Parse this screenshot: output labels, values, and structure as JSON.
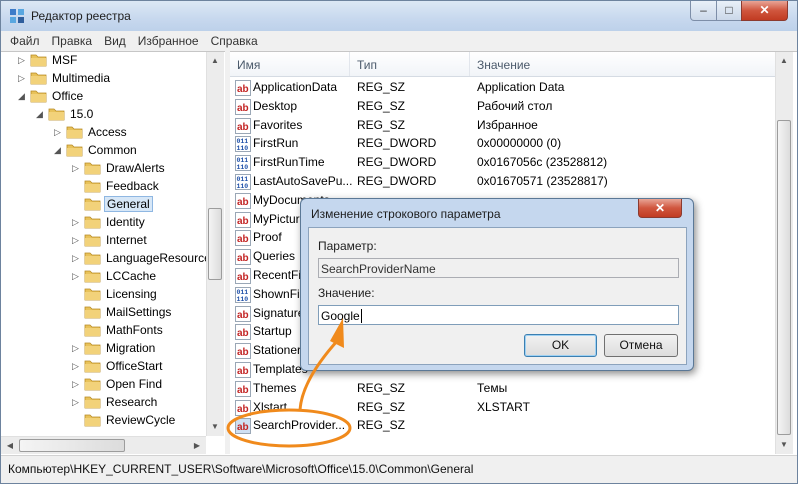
{
  "window": {
    "title": "Редактор реестра"
  },
  "caption": {
    "minimize": "–",
    "maximize": "□",
    "close": "✕"
  },
  "menu": [
    "Файл",
    "Правка",
    "Вид",
    "Избранное",
    "Справка"
  ],
  "tree": [
    {
      "label": "MSF",
      "level": 1,
      "expander": "▷"
    },
    {
      "label": "Multimedia",
      "level": 1,
      "expander": "▷"
    },
    {
      "label": "Office",
      "level": 1,
      "expander": "◢"
    },
    {
      "label": "15.0",
      "level": 2,
      "expander": "◢"
    },
    {
      "label": "Access",
      "level": 3,
      "expander": "▷"
    },
    {
      "label": "Common",
      "level": 3,
      "expander": "◢"
    },
    {
      "label": "DrawAlerts",
      "level": 4,
      "expander": "▷"
    },
    {
      "label": "Feedback",
      "level": 4,
      "expander": ""
    },
    {
      "label": "General",
      "level": 4,
      "expander": "",
      "selected": true
    },
    {
      "label": "Identity",
      "level": 4,
      "expander": "▷"
    },
    {
      "label": "Internet",
      "level": 4,
      "expander": "▷"
    },
    {
      "label": "LanguageResources",
      "level": 4,
      "expander": "▷"
    },
    {
      "label": "LCCache",
      "level": 4,
      "expander": "▷"
    },
    {
      "label": "Licensing",
      "level": 4,
      "expander": ""
    },
    {
      "label": "MailSettings",
      "level": 4,
      "expander": ""
    },
    {
      "label": "MathFonts",
      "level": 4,
      "expander": ""
    },
    {
      "label": "Migration",
      "level": 4,
      "expander": "▷"
    },
    {
      "label": "OfficeStart",
      "level": 4,
      "expander": "▷"
    },
    {
      "label": "Open Find",
      "level": 4,
      "expander": "▷"
    },
    {
      "label": "Research",
      "level": 4,
      "expander": "▷"
    },
    {
      "label": "ReviewCycle",
      "level": 4,
      "expander": ""
    }
  ],
  "list": {
    "headers": {
      "name": "Имя",
      "type": "Тип",
      "value": "Значение"
    },
    "rows": [
      {
        "name": "ApplicationData",
        "type": "REG_SZ",
        "value": "Application Data",
        "icon": "ab"
      },
      {
        "name": "Desktop",
        "type": "REG_SZ",
        "value": "Рабочий стол",
        "icon": "ab"
      },
      {
        "name": "Favorites",
        "type": "REG_SZ",
        "value": "Избранное",
        "icon": "ab"
      },
      {
        "name": "FirstRun",
        "type": "REG_DWORD",
        "value": "0x00000000 (0)",
        "icon": "bin"
      },
      {
        "name": "FirstRunTime",
        "type": "REG_DWORD",
        "value": "0x0167056c (23528812)",
        "icon": "bin"
      },
      {
        "name": "LastAutoSavePu...",
        "type": "REG_DWORD",
        "value": "0x01670571 (23528817)",
        "icon": "bin"
      },
      {
        "name": "MyDocuments",
        "type": "",
        "value": "",
        "icon": "ab"
      },
      {
        "name": "MyPictures",
        "type": "",
        "value": "",
        "icon": "ab"
      },
      {
        "name": "Proof",
        "type": "",
        "value": "",
        "icon": "ab"
      },
      {
        "name": "Queries",
        "type": "",
        "value": "",
        "icon": "ab"
      },
      {
        "name": "RecentFiles",
        "type": "",
        "value": "",
        "icon": "ab"
      },
      {
        "name": "ShownFirstRun",
        "type": "",
        "value": "",
        "icon": "bin"
      },
      {
        "name": "Signatures",
        "type": "",
        "value": "",
        "icon": "ab"
      },
      {
        "name": "Startup",
        "type": "",
        "value": "",
        "icon": "ab"
      },
      {
        "name": "Stationery",
        "type": "",
        "value": "",
        "icon": "ab"
      },
      {
        "name": "Templates",
        "type": "",
        "value": "",
        "icon": "ab"
      },
      {
        "name": "Themes",
        "type": "REG_SZ",
        "value": "Темы",
        "icon": "ab"
      },
      {
        "name": "Xlstart",
        "type": "REG_SZ",
        "value": "XLSTART",
        "icon": "ab"
      },
      {
        "name": "SearchProvider...",
        "type": "REG_SZ",
        "value": "",
        "icon": "ab",
        "selected": true
      }
    ]
  },
  "status": "Компьютер\\HKEY_CURRENT_USER\\Software\\Microsoft\\Office\\15.0\\Common\\General",
  "dialog": {
    "title": "Изменение строкового параметра",
    "param_label": "Параметр:",
    "param_value": "SearchProviderName",
    "value_label": "Значение:",
    "value_text": "Google",
    "ok": "OK",
    "cancel": "Отмена",
    "close": "✕"
  },
  "colors": {
    "annotation": "#f08a1c",
    "selection": "#d7e7f7",
    "folder": "#e8c25a"
  }
}
